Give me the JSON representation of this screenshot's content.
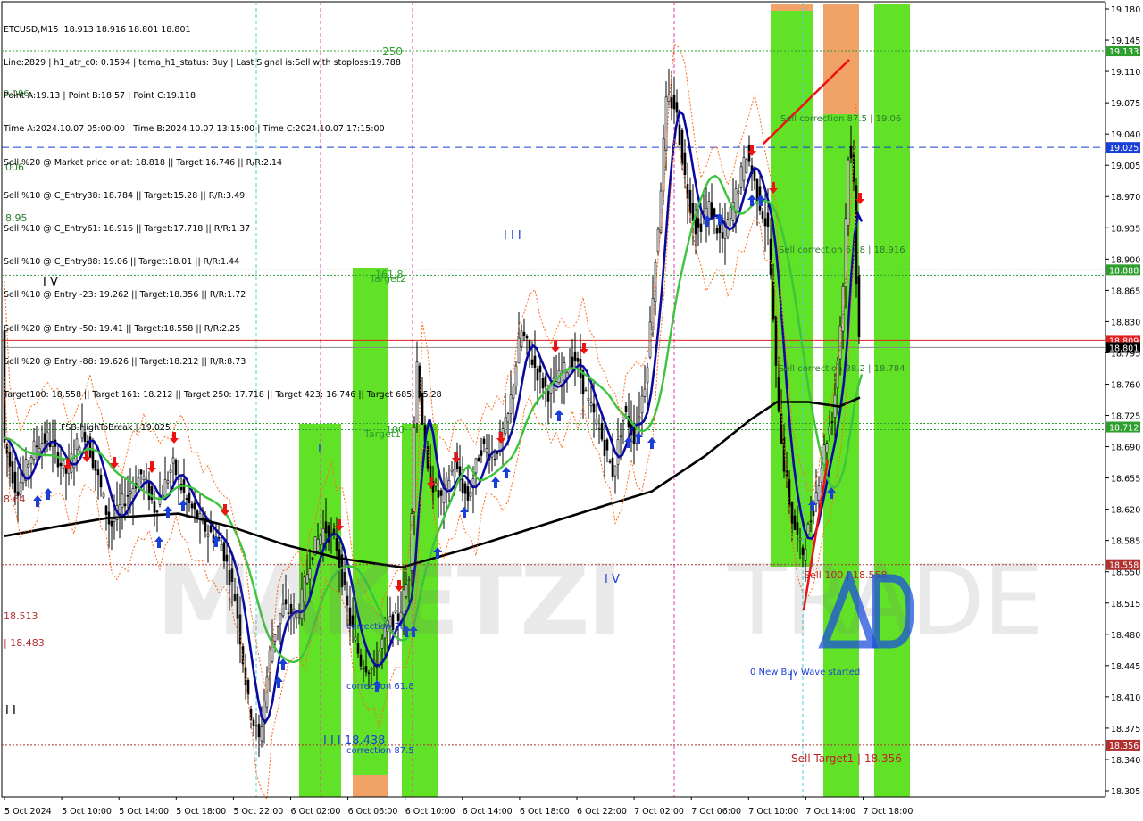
{
  "chart_data": {
    "type": "candlestick",
    "symbol": "ETCUSD,M15",
    "ohlc_header": "18.913 18.916 18.801 18.801",
    "info_lines": [
      "ETCUSD,M15  18.913 18.916 18.801 18.801",
      "Line:2829 | h1_atr_c0: 0.1594 | tema_h1_status: Buy | Last Signal is:Sell with stoploss:19.788",
      "Point A:19.13 | Point B:18.57 | Point C:19.118",
      "Time A:2024.10.07 05:00:00 | Time B:2024.10.07 13:15:00 | Time C:2024.10.07 17:15:00",
      "Sell %20 @ Market price or at: 18.818 || Target:16.746 || R/R:2.14",
      "Sell %10 @ C_Entry38: 18.784 || Target:15.28 || R/R:3.49",
      "Sell %10 @ C_Entry61: 18.916 || Target:17.718 || R/R:1.37",
      "Sell %10 @ C_Entry88: 19.06 || Target:18.01 || R/R:1.44",
      "Sell %10 @ Entry -23: 19.262 || Target:18.356 || R/R:1.72",
      "Sell %20 @ Entry -50: 19.41 || Target:18.558 || R/R:2.25",
      "Sell %20 @ Entry -88: 19.626 || Target:18.212 || R/R:8.73",
      "Target100: 18.558 || Target 161: 18.212 || Target 250: 17.718 || Target 423: 16.746 || Target 685: 15.28",
      "FSB-HighToBreak | 19.025"
    ],
    "y_ticks": [
      "19.180",
      "19.145",
      "19.110",
      "19.075",
      "19.040",
      "19.005",
      "18.970",
      "18.935",
      "18.900",
      "18.865",
      "18.830",
      "18.795",
      "18.760",
      "18.725",
      "18.690",
      "18.655",
      "18.620",
      "18.585",
      "18.550",
      "18.515",
      "18.480",
      "18.445",
      "18.410",
      "18.375",
      "18.340",
      "18.305"
    ],
    "x_ticks": [
      "5 Oct 2024",
      "5 Oct 10:00",
      "5 Oct 14:00",
      "5 Oct 18:00",
      "5 Oct 22:00",
      "6 Oct 02:00",
      "6 Oct 06:00",
      "6 Oct 10:00",
      "6 Oct 14:00",
      "6 Oct 18:00",
      "6 Oct 22:00",
      "7 Oct 02:00",
      "7 Oct 06:00",
      "7 Oct 10:00",
      "7 Oct 14:00",
      "7 Oct 18:00"
    ],
    "ylim": [
      18.298,
      19.185
    ],
    "price_labels": [
      {
        "value": 19.133,
        "text": "19.133",
        "color": "#2e9e2e"
      },
      {
        "value": 19.025,
        "text": "19.025",
        "color": "#1a3fd6"
      },
      {
        "value": 18.888,
        "text": "18.888",
        "color": "#2e9e2e"
      },
      {
        "value": 18.809,
        "text": "18.809",
        "color": "#e02020"
      },
      {
        "value": 18.801,
        "text": "18.801",
        "color": "#000000"
      },
      {
        "value": 18.712,
        "text": "18.712",
        "color": "#2e9e2e"
      },
      {
        "value": 18.558,
        "text": "18.558",
        "color": "#b03030"
      },
      {
        "value": 18.356,
        "text": "18.356",
        "color": "#b03030"
      }
    ],
    "annotations": [
      {
        "text": "250",
        "color": "#2e9e2e"
      },
      {
        "text": "Target2",
        "color": "#2e9e2e"
      },
      {
        "text": "161.8",
        "color": "#2e9e2e"
      },
      {
        "text": "Target1",
        "color": "#2e9e2e"
      },
      {
        "text": "100",
        "color": "#2e9e2e"
      },
      {
        "text": "I V",
        "color": "#000000"
      },
      {
        "text": "I I I",
        "color": "#1a3fd6"
      },
      {
        "text": "I V",
        "color": "#1a3fd6"
      },
      {
        "text": "I",
        "color": "#1a3fd6"
      },
      {
        "text": "I I",
        "color": "#000000"
      },
      {
        "text": "I I I 18.438",
        "color": "#1a3fd6"
      },
      {
        "text": "correction 38",
        "color": "#1a3fd6"
      },
      {
        "text": "correction 61.8",
        "color": "#1a3fd6"
      },
      {
        "text": "correction 87.5",
        "color": "#1a3fd6"
      },
      {
        "text": "Sell correction 87.5 | 19.06",
        "color": "#2e7a2e"
      },
      {
        "text": "Sell correction 61.8 | 18.916",
        "color": "#2e7a2e"
      },
      {
        "text": "Sell correction 38.2 | 18.784",
        "color": "#2e7a2e"
      },
      {
        "text": "Sell 100 | 18.558",
        "color": "#c02020"
      },
      {
        "text": "Sell Target1 | 18.356",
        "color": "#c02020"
      },
      {
        "text": "0 New Buy Wave started",
        "color": "#1a3fd6"
      },
      {
        "text": "18.513",
        "color": "#b03030"
      },
      {
        "text": "| 18.483",
        "color": "#b03030"
      },
      {
        "text": "8.64",
        "color": "#b03030"
      },
      {
        "text": "8.95",
        "color": "#2e7a2e"
      },
      {
        "text": "006",
        "color": "#2e7a2e"
      },
      {
        "text": "9.086",
        "color": "#2e7a2e"
      },
      {
        "text": "I",
        "color": "#1a3fd6"
      }
    ],
    "watermark": {
      "brand": "MAKETZI",
      "suffix": "TRADE"
    }
  }
}
